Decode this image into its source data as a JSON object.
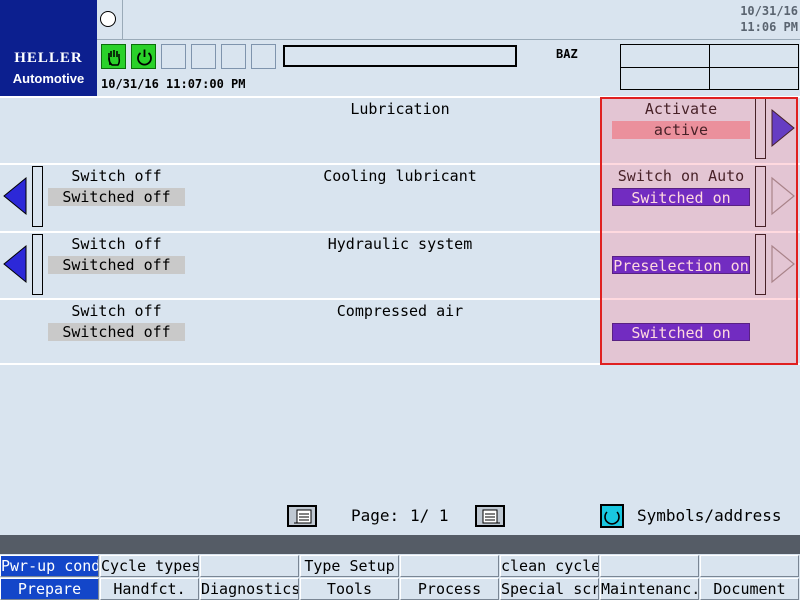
{
  "header": {
    "logo_line1": "HELLER",
    "logo_line2": "Automotive",
    "clock_date": "10/31/16",
    "clock_time": "11:06 PM",
    "channel": "BAZ",
    "message_timestamp": "10/31/16 11:07:00 PM",
    "message_text": ""
  },
  "rows": [
    {
      "title": "Lubrication",
      "left_label": "",
      "left_value": "",
      "right_label": "Activate",
      "right_value": "active",
      "right_value_style": "pink"
    },
    {
      "title": "Cooling lubricant",
      "left_label": "Switch off",
      "left_value": "Switched off",
      "right_label": "Switch on Auto",
      "right_value": "Switched on",
      "right_value_style": "blue"
    },
    {
      "title": "Hydraulic system",
      "left_label": "Switch off",
      "left_value": "Switched off",
      "right_label": "",
      "right_value": "Preselection on",
      "right_value_style": "blue"
    },
    {
      "title": "Compressed air",
      "left_label": "Switch off",
      "left_value": "Switched off",
      "right_label": "",
      "right_value": "Switched on",
      "right_value_style": "blue"
    }
  ],
  "pager": {
    "label": "Page:",
    "value": "1/ 1",
    "symbols_label": "Symbols/address"
  },
  "softkeys": {
    "top": [
      "Pwr-up cond",
      "Cycle types",
      "",
      "Type Setup",
      "",
      "clean cycle",
      "",
      ""
    ],
    "bottom": [
      "Prepare",
      "Handfct.",
      "Diagnostics",
      "Tools",
      "Process",
      "Special scre",
      "Maintenanc.",
      "Document"
    ]
  },
  "colors": {
    "logo_bg": "#0c1f8f",
    "active_softkey": "#1346c9",
    "value_blue": "#3c10d6",
    "value_pink": "#e39aa3",
    "highlight": "#e02020",
    "indicator_green": "#2ad12a"
  },
  "icons": {
    "indicator_1": "hand-stop-icon",
    "indicator_2": "power-icon",
    "page_prev": "page-prev-icon",
    "page_next": "page-next-icon",
    "symbols": "cycle-icon"
  }
}
